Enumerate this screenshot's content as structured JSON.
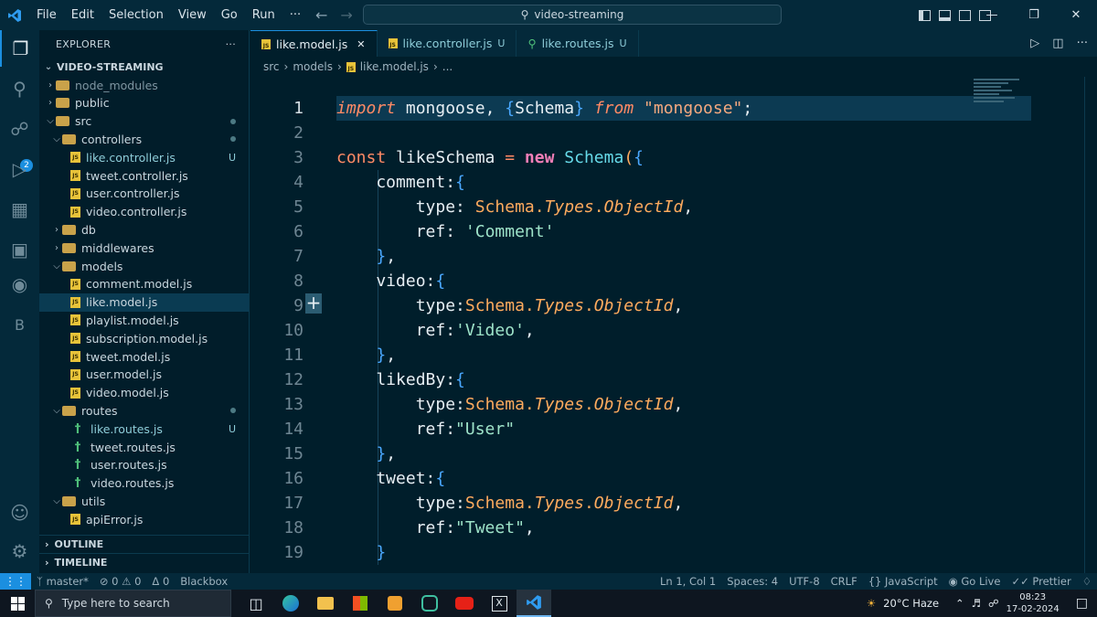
{
  "titlebar": {
    "menu": [
      "File",
      "Edit",
      "Selection",
      "View",
      "Go",
      "Run",
      "···"
    ],
    "search_text": "video-streaming",
    "window_controls": [
      "—",
      "❐",
      "✕"
    ]
  },
  "activity": {
    "scm_badge": "2",
    "account_letter": "B"
  },
  "explorer": {
    "title": "EXPLORER",
    "more": "···",
    "root": "VIDEO-STREAMING",
    "items": [
      {
        "label": "node_modules",
        "type": "folder",
        "dim": true
      },
      {
        "label": "public",
        "type": "folder"
      },
      {
        "label": "src",
        "type": "folder",
        "open": true
      },
      {
        "label": "controllers",
        "type": "folder",
        "open": true
      },
      {
        "label": "like.controller.js",
        "type": "js",
        "status": "U"
      },
      {
        "label": "tweet.controller.js",
        "type": "js"
      },
      {
        "label": "user.controller.js",
        "type": "js"
      },
      {
        "label": "video.controller.js",
        "type": "js"
      },
      {
        "label": "db",
        "type": "folder"
      },
      {
        "label": "middlewares",
        "type": "folder"
      },
      {
        "label": "models",
        "type": "folder",
        "open": true
      },
      {
        "label": "comment.model.js",
        "type": "js"
      },
      {
        "label": "like.model.js",
        "type": "js",
        "selected": true
      },
      {
        "label": "playlist.model.js",
        "type": "js"
      },
      {
        "label": "subscription.model.js",
        "type": "js"
      },
      {
        "label": "tweet.model.js",
        "type": "js"
      },
      {
        "label": "user.model.js",
        "type": "js"
      },
      {
        "label": "video.model.js",
        "type": "js"
      },
      {
        "label": "routes",
        "type": "folder",
        "open": true
      },
      {
        "label": "like.routes.js",
        "type": "route",
        "status": "U"
      },
      {
        "label": "tweet.routes.js",
        "type": "route"
      },
      {
        "label": "user.routes.js",
        "type": "route"
      },
      {
        "label": "video.routes.js",
        "type": "route"
      },
      {
        "label": "utils",
        "type": "folder",
        "open": true
      },
      {
        "label": "apiError.js",
        "type": "js"
      }
    ],
    "outline": "OUTLINE",
    "timeline": "TIMELINE"
  },
  "tabs": [
    {
      "label": "like.model.js",
      "active": true,
      "close": "✕"
    },
    {
      "label": "like.controller.js",
      "status": "U"
    },
    {
      "label": "like.routes.js",
      "status": "U"
    }
  ],
  "breadcrumb": [
    "src",
    "models",
    "like.model.js",
    "..."
  ],
  "editor": {
    "line_numbers": [
      "1",
      "2",
      "3",
      "4",
      "5",
      "6",
      "7",
      "8",
      "9",
      "10",
      "11",
      "12",
      "13",
      "14",
      "15",
      "16",
      "17",
      "18",
      "19"
    ],
    "current_line": "1"
  },
  "status": {
    "branch": "master*",
    "problems": "⊘ 0 ⚠ 0",
    "ports": "Δ 0",
    "blackbox": "Blackbox",
    "position": "Ln 1, Col 1",
    "spaces": "Spaces: 4",
    "encoding": "UTF-8",
    "eol": "CRLF",
    "language": "JavaScript",
    "golive": "Go Live",
    "prettier": "Prettier"
  },
  "taskbar": {
    "search_placeholder": "Type here to search",
    "weather": "20°C  Haze",
    "time": "08:23",
    "date": "17-02-2024"
  },
  "colors": {
    "accent": "#1b8fe0",
    "background": "#001e2b",
    "panel": "#04293a"
  }
}
